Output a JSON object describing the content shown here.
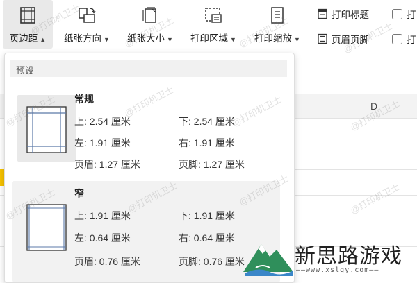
{
  "ribbon": {
    "buttons": [
      {
        "label": "页边距",
        "icon": "margins-icon",
        "active": true
      },
      {
        "label": "纸张方向",
        "icon": "orientation-icon"
      },
      {
        "label": "纸张大小",
        "icon": "paper-size-icon"
      },
      {
        "label": "打印区域",
        "icon": "print-area-icon"
      },
      {
        "label": "打印缩放",
        "icon": "print-scale-icon"
      }
    ],
    "small_buttons": [
      {
        "label": "打印标题",
        "icon": "print-title-icon"
      },
      {
        "label": "页眉页脚",
        "icon": "header-footer-icon"
      }
    ],
    "checkboxes": [
      {
        "label": "打"
      },
      {
        "label": "打"
      }
    ]
  },
  "sheet": {
    "column_label": "D"
  },
  "dropdown": {
    "section_label": "预设",
    "presets": [
      {
        "name": "常规",
        "top": "上: 2.54 厘米",
        "bottom": "下: 2.54 厘米",
        "left": "左: 1.91 厘米",
        "right": "右: 1.91 厘米",
        "header": "页眉: 1.27 厘米",
        "footer": "页脚: 1.27 厘米"
      },
      {
        "name": "窄",
        "top": "上: 1.91 厘米",
        "bottom": "下: 1.91 厘米",
        "left": "左: 0.64 厘米",
        "right": "右: 0.64 厘米",
        "header": "页眉: 0.76 厘米",
        "footer": "页脚: 0.76 厘米"
      }
    ]
  },
  "watermark": {
    "text": "@打印机卫士"
  },
  "logo": {
    "text": "新思路游戏",
    "url": "——www.xslgy.com——"
  },
  "colors": {
    "accent_yellow": "#f7c300",
    "active_bg": "#e9e9e9",
    "logo_green": "#2f8f5b",
    "logo_blue": "#3a86c8"
  }
}
